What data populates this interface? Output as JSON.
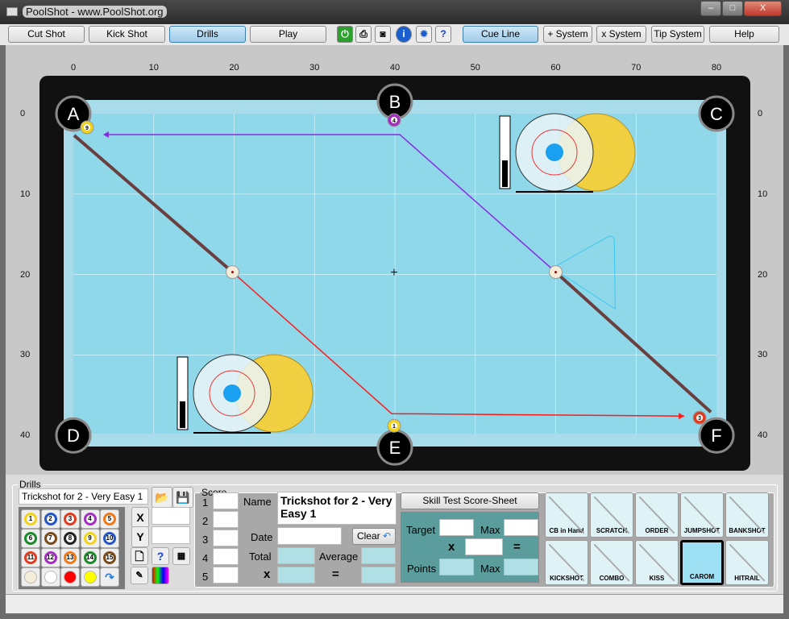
{
  "window": {
    "title": "PoolShot - www.PoolShot.org",
    "minimize": "–",
    "maximize": "□",
    "close": "X"
  },
  "toolbar": {
    "cut_shot": "Cut Shot",
    "kick_shot": "Kick Shot",
    "drills": "Drills",
    "play": "Play",
    "cue_line": "Cue Line",
    "plus_system": "+ System",
    "x_system": "x System",
    "tip_system": "Tip System",
    "help": "Help",
    "icons": [
      "power-icon",
      "print-icon",
      "camera-icon",
      "info-icon",
      "settings-icon",
      "help-doc-icon"
    ]
  },
  "table": {
    "x_ticks": [
      "0",
      "10",
      "20",
      "30",
      "40",
      "50",
      "60",
      "70",
      "80"
    ],
    "y_ticks": [
      "0",
      "10",
      "20",
      "30",
      "40"
    ],
    "pockets": [
      "A",
      "B",
      "C",
      "D",
      "E",
      "F"
    ],
    "colors": {
      "felt": "#8fd8ea",
      "rail": "#0a0a0a",
      "cue_path": "#ff1a1a",
      "object_path": "#8a2be2",
      "aim_line": "#6b3f3f"
    }
  },
  "drills": {
    "legend": "Drills",
    "drill_name": "Trickshot for 2 - Very Easy 1",
    "balls": [
      "1",
      "2",
      "3",
      "4",
      "5",
      "6",
      "7",
      "8",
      "9",
      "10",
      "11",
      "12",
      "13",
      "14",
      "15"
    ],
    "x_label": "X",
    "y_label": "Y",
    "x_value": "",
    "y_value": ""
  },
  "score": {
    "legend": "Score",
    "rows": [
      "1",
      "2",
      "3",
      "4",
      "5"
    ],
    "name_label": "Name",
    "name_value": "Trickshot for 2 - Very Easy 1",
    "date_label": "Date",
    "clear": "Clear",
    "total_label": "Total",
    "average_label": "Average",
    "x_label": "x",
    "eq_label": "=",
    "skill_test": "Skill Test Score-Sheet",
    "target_label": "Target",
    "max_label": "Max",
    "points_label": "Points",
    "max2_label": "Max",
    "x2": "x",
    "eq2": "="
  },
  "shot_types": [
    {
      "label": "CB in Hand"
    },
    {
      "label": "SCRATCH"
    },
    {
      "label": "ORDER"
    },
    {
      "label": "JUMPSHOT"
    },
    {
      "label": "BANKSHOT"
    },
    {
      "label": "KICKSHOT"
    },
    {
      "label": "COMBO"
    },
    {
      "label": "KISS"
    },
    {
      "label": "CAROM",
      "selected": true
    },
    {
      "label": "HITRAIL"
    }
  ]
}
